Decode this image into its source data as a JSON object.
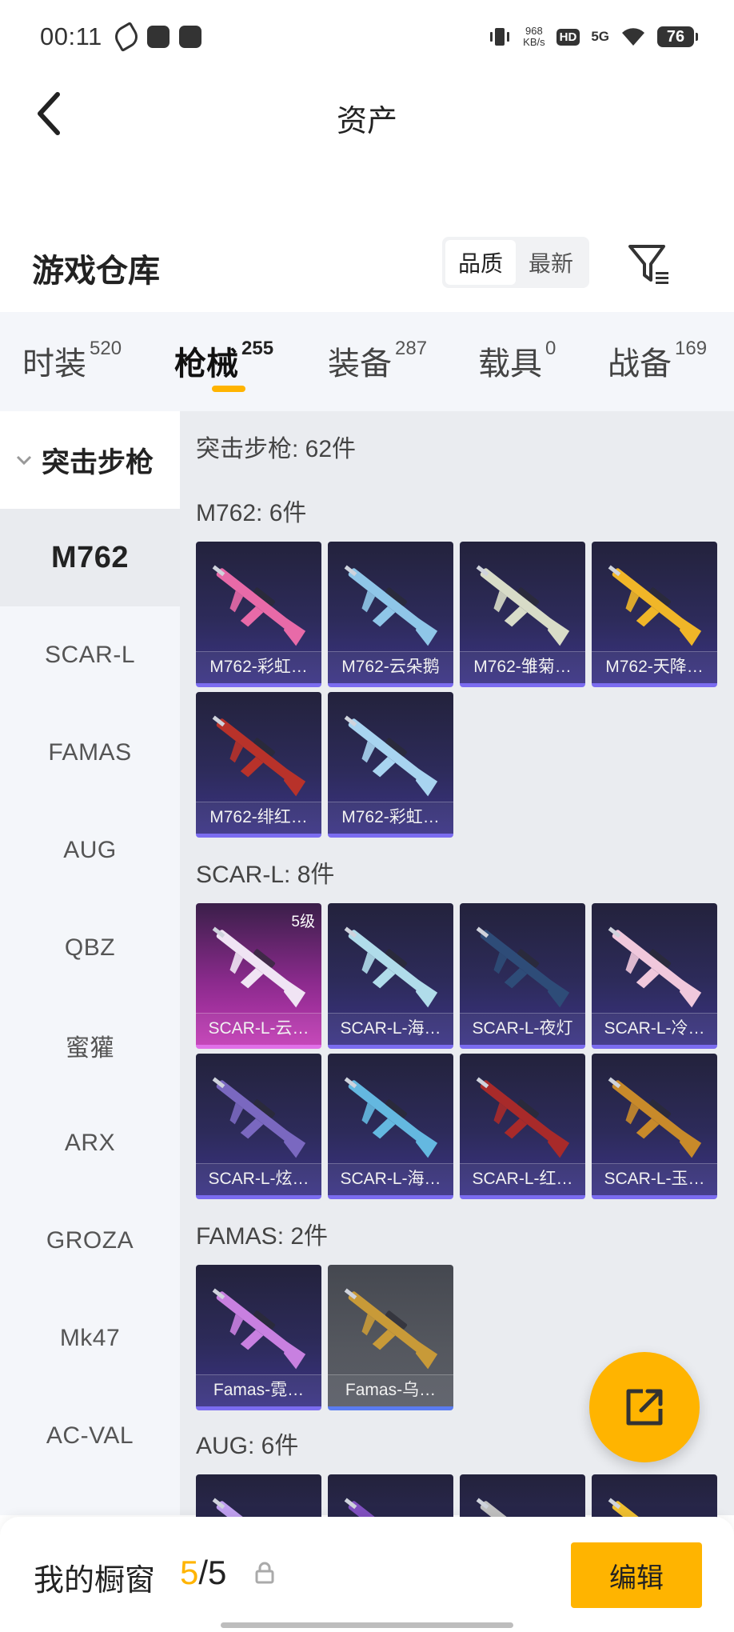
{
  "status_bar": {
    "time": "00:11",
    "speed": "968",
    "speed_unit": "KB/s",
    "hd": "HD",
    "network": "5G",
    "battery": "76"
  },
  "header": {
    "title": "资产",
    "back_icon": "chevron-left-icon"
  },
  "repository": {
    "title": "游戏仓库",
    "sort_options": [
      "品质",
      "最新"
    ],
    "sort_selected": "品质",
    "filter_icon": "filter-icon"
  },
  "tabs": [
    {
      "label": "时装",
      "count": "520"
    },
    {
      "label": "枪械",
      "count": "255",
      "active": true
    },
    {
      "label": "装备",
      "count": "287"
    },
    {
      "label": "载具",
      "count": "0"
    },
    {
      "label": "战备",
      "count": "169"
    }
  ],
  "sidebar": {
    "group": "突击步枪",
    "items": [
      "M762",
      "SCAR-L",
      "FAMAS",
      "AUG",
      "QBZ",
      "蜜獾",
      "ARX",
      "GROZA",
      "Mk47",
      "AC-VAL"
    ],
    "active": "M762"
  },
  "content": {
    "summary": "突击步枪: 62件",
    "sections": [
      {
        "title": "M762: 6件",
        "items": [
          {
            "label": "M762-彩虹…",
            "gun_color": "#e86aa8"
          },
          {
            "label": "M762-云朵鹅",
            "gun_color": "#8fc6e8"
          },
          {
            "label": "M762-雏菊…",
            "gun_color": "#d8dcc8"
          },
          {
            "label": "M762-天降…",
            "gun_color": "#f0b628"
          },
          {
            "label": "M762-绯红…",
            "gun_color": "#b8322a"
          },
          {
            "label": "M762-彩虹…",
            "gun_color": "#a8d4f0"
          }
        ]
      },
      {
        "title": "SCAR-L: 8件",
        "items": [
          {
            "label": "SCAR-L-云…",
            "gun_color": "#f0e4f4",
            "level": "5级",
            "style": "pink"
          },
          {
            "label": "SCAR-L-海…",
            "gun_color": "#b0dcea"
          },
          {
            "label": "SCAR-L-夜灯",
            "gun_color": "#2e4c78"
          },
          {
            "label": "SCAR-L-冷…",
            "gun_color": "#f0c8dc"
          },
          {
            "label": "SCAR-L-炫…",
            "gun_color": "#7a68c0"
          },
          {
            "label": "SCAR-L-海…",
            "gun_color": "#64b8e0"
          },
          {
            "label": "SCAR-L-红…",
            "gun_color": "#a82a2a"
          },
          {
            "label": "SCAR-L-玉…",
            "gun_color": "#c88a2a"
          }
        ]
      },
      {
        "title": "FAMAS: 2件",
        "items": [
          {
            "label": "Famas-霓…",
            "gun_color": "#c880e0"
          },
          {
            "label": "Famas-乌…",
            "gun_color": "#c89a38",
            "style": "gray"
          }
        ]
      },
      {
        "title": "AUG: 6件",
        "items": [
          {
            "label": "",
            "gun_color": "#c0a0f0"
          },
          {
            "label": "",
            "gun_color": "#8050c0"
          },
          {
            "label": "",
            "gun_color": "#c0c0c0"
          },
          {
            "label": "",
            "gun_color": "#f0c030"
          }
        ]
      }
    ]
  },
  "fab": {
    "icon": "share-icon"
  },
  "bottom_bar": {
    "title": "我的橱窗",
    "count_current": "5",
    "count_sep": "/",
    "count_total": "5",
    "lock_icon": "lock-icon",
    "edit_label": "编辑"
  }
}
